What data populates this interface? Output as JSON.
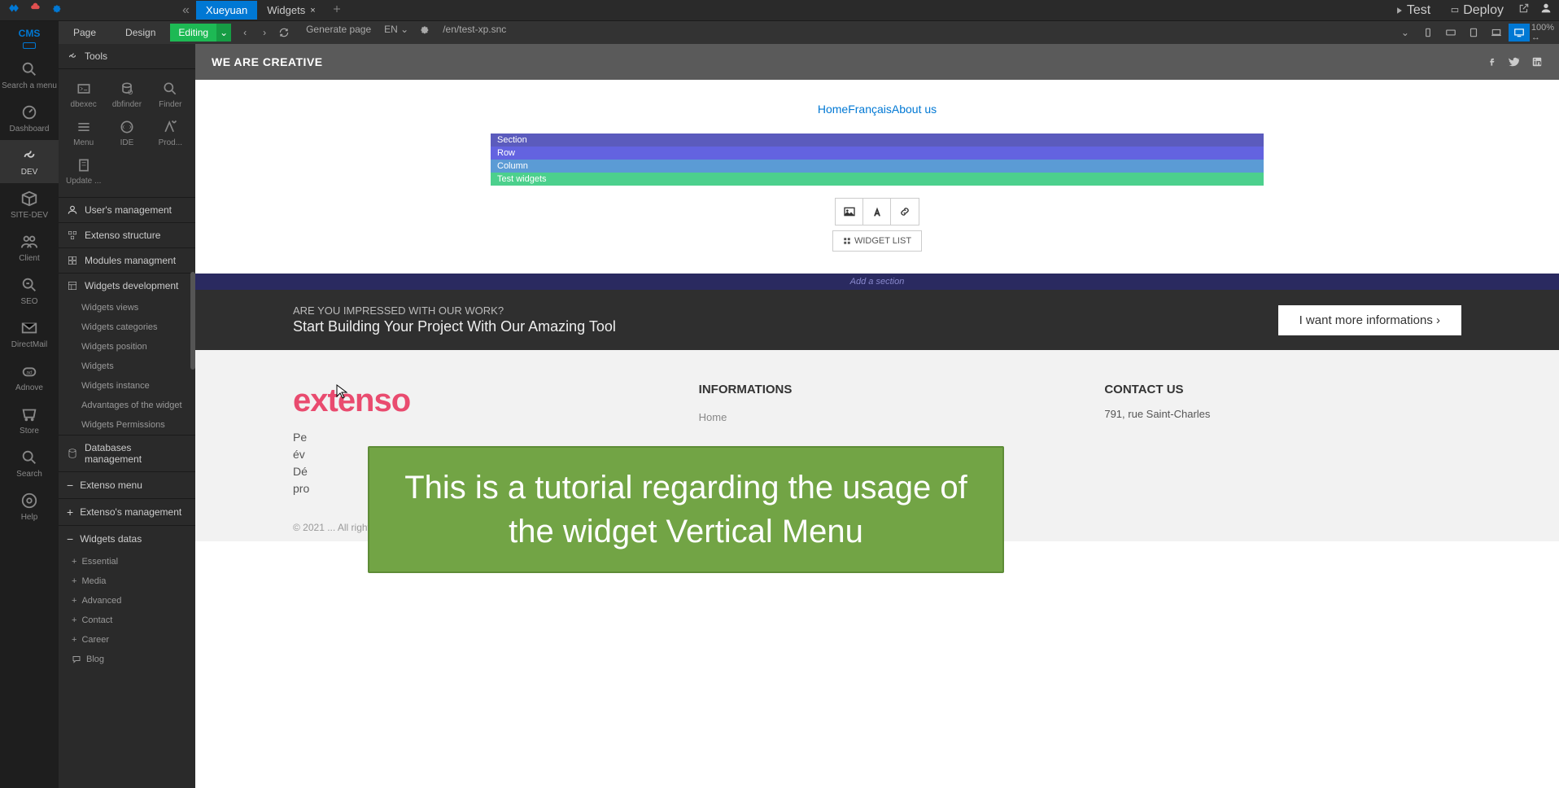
{
  "topbar": {
    "test": "Test",
    "deploy": "Deploy"
  },
  "tabs": {
    "t1": "Xueyuan",
    "t2": "Widgets"
  },
  "toolbar": {
    "cms": "CMS",
    "page": "Page",
    "design": "Design",
    "editing": "Editing",
    "generate": "Generate page",
    "lang": "EN",
    "path": "/en/test-xp.snc",
    "pct": "100%"
  },
  "rail": {
    "search": "Search a menu",
    "dashboard": "Dashboard",
    "dev": "DEV",
    "sitedev": "SITE-DEV",
    "client": "Client",
    "seo": "SEO",
    "directmail": "DirectMail",
    "adnove": "Adnove",
    "store": "Store",
    "search2": "Search",
    "help": "Help"
  },
  "sidepanel": {
    "tools": "Tools",
    "grid": {
      "dbexec": "dbexec",
      "dbfinder": "dbfinder",
      "finder": "Finder",
      "menu": "Menu",
      "ide": "IDE",
      "prod": "Prod...",
      "update": "Update ..."
    },
    "sections": {
      "users": "User's management",
      "extenso": "Extenso structure",
      "modules": "Modules managment",
      "widgets_dev": "Widgets development",
      "db": "Databases management",
      "ext_menu": "Extenso menu",
      "ext_mgmt": "Extenso's management",
      "widgets_data": "Widgets datas"
    },
    "wd_sub": {
      "views": "Widgets views",
      "categories": "Widgets categories",
      "position": "Widgets position",
      "widgets": "Widgets",
      "instance": "Widgets instance",
      "advantages": "Advantages of the widget",
      "permissions": "Widgets Permissions"
    },
    "wdata_sub": {
      "essential": "Essential",
      "media": "Media",
      "advanced": "Advanced",
      "contact": "Contact",
      "career": "Career",
      "blog": "Blog"
    }
  },
  "canvas": {
    "header": "WE ARE CREATIVE",
    "nav": {
      "home": "Home",
      "fr": "Français",
      "about": "About us"
    },
    "edit": {
      "section": "Section",
      "row": "Row",
      "column": "Column",
      "test": "Test widgets",
      "widget_list": "WIDGET LIST",
      "add_section": "Add a section"
    },
    "cta": {
      "q": "ARE YOU IMPRESSED WITH OUR WORK?",
      "sub": "Start Building Your Project With Our Amazing Tool",
      "btn": "I want more informations ›"
    },
    "footer": {
      "logo": "extenso",
      "desc_line1": "Pe",
      "desc_line2": "év",
      "desc_line3": "Dé",
      "desc_line4": "pro",
      "info_h": "INFORMATIONS",
      "info_home": "Home",
      "contact_h": "CONTACT US",
      "addr": "791, rue Saint-Charles"
    },
    "copyright": "© 2021 ... All rights ..."
  },
  "overlay": {
    "text": "This is a tutorial regarding the usage of the widget Vertical Menu"
  }
}
